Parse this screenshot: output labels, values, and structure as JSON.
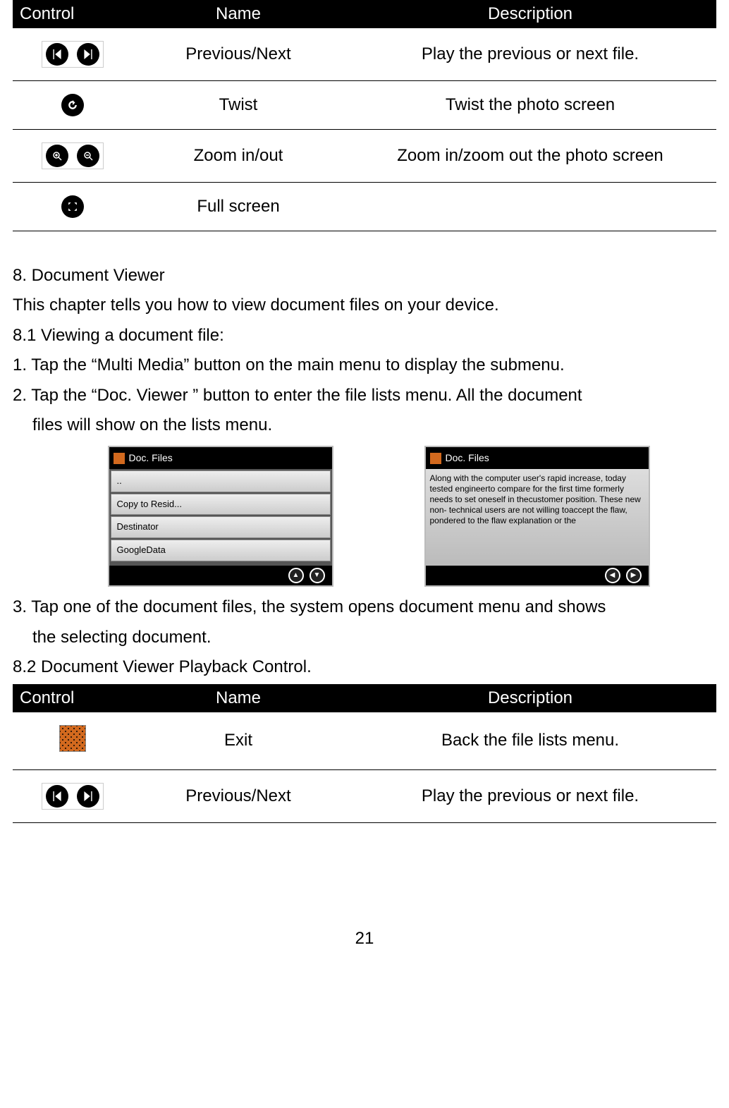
{
  "page_number": "21",
  "table1": {
    "headers": [
      "Control",
      "Name",
      "Description"
    ],
    "rows": [
      {
        "name": "Previous/Next",
        "desc": "Play the previous or next file."
      },
      {
        "name": "Twist",
        "desc": "Twist the photo screen"
      },
      {
        "name": "Zoom in/out",
        "desc": "Zoom in/zoom out the photo screen"
      },
      {
        "name": "Full screen",
        "desc": ""
      }
    ]
  },
  "section8": {
    "heading": "8. Document Viewer",
    "intro": "This chapter tells you how to view document files on your device.",
    "sub81": "8.1 Viewing a document file:",
    "step1": "1. Tap the “Multi Media” button on the main menu to display the submenu.",
    "step2a": "2. Tap the “Doc. Viewer ” button to enter the file lists menu. All the document",
    "step2b": "files will show on the lists menu.",
    "step3a": "3.  Tap one of the document files, the system opens document menu and shows",
    "step3b": "the selecting document.",
    "sub82": "8.2 Document Viewer Playback Control."
  },
  "mock_left": {
    "title": "Doc. Files",
    "rows": [
      "..",
      "Copy to Resid...",
      "Destinator",
      "GoogleData"
    ]
  },
  "mock_right": {
    "title": "Doc. Files",
    "body": "Along with the computer user's rapid increase, today tested engineerto compare for the first time formerly needs to set oneself in thecustomer position. These new non- technical users are not willing toaccept the flaw, pondered to the flaw explanation or the"
  },
  "table2": {
    "headers": [
      "Control",
      "Name",
      "Description"
    ],
    "rows": [
      {
        "name": "Exit",
        "desc": "Back the file lists menu."
      },
      {
        "name": "Previous/Next",
        "desc": "Play the previous or next file."
      }
    ]
  }
}
